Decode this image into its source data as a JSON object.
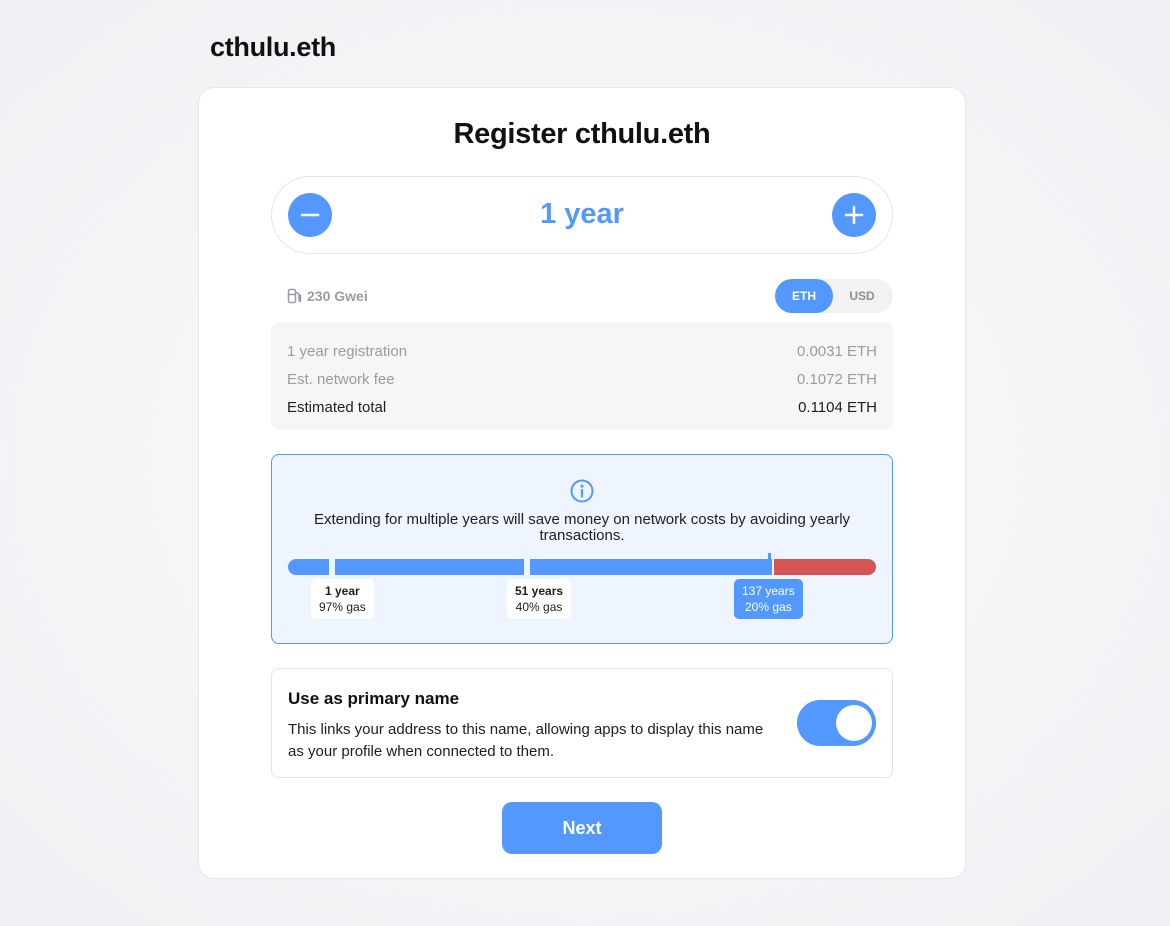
{
  "site_name": "cthulu.eth",
  "title": "Register cthulu.eth",
  "duration": {
    "value": "1 year"
  },
  "gas": {
    "label": "230 Gwei"
  },
  "currency": {
    "options": [
      "ETH",
      "USD"
    ],
    "selected": "ETH"
  },
  "invoice": {
    "rows": [
      {
        "label": "1 year registration",
        "value": "0.0031 ETH"
      },
      {
        "label": "Est. network fee",
        "value": "0.1072 ETH"
      }
    ],
    "total": {
      "label": "Estimated total",
      "value": "0.1104 ETH"
    }
  },
  "savings": {
    "message": "Extending for multiple years will save money on network costs by avoiding yearly transactions.",
    "ticks": [
      {
        "years": "1 year",
        "gas": "97% gas",
        "active": false
      },
      {
        "years": "51 years",
        "gas": "40% gas",
        "active": false
      },
      {
        "years": "137 years",
        "gas": "20% gas",
        "active": true
      }
    ]
  },
  "primary_name": {
    "title": "Use as primary name",
    "description": "This links your address to this name, allowing apps to display this name as your profile when connected to them.",
    "enabled": true
  },
  "next_label": "Next",
  "colors": {
    "accent": "#5298ff",
    "danger": "#d55555",
    "info_bg": "#eef5ff"
  }
}
